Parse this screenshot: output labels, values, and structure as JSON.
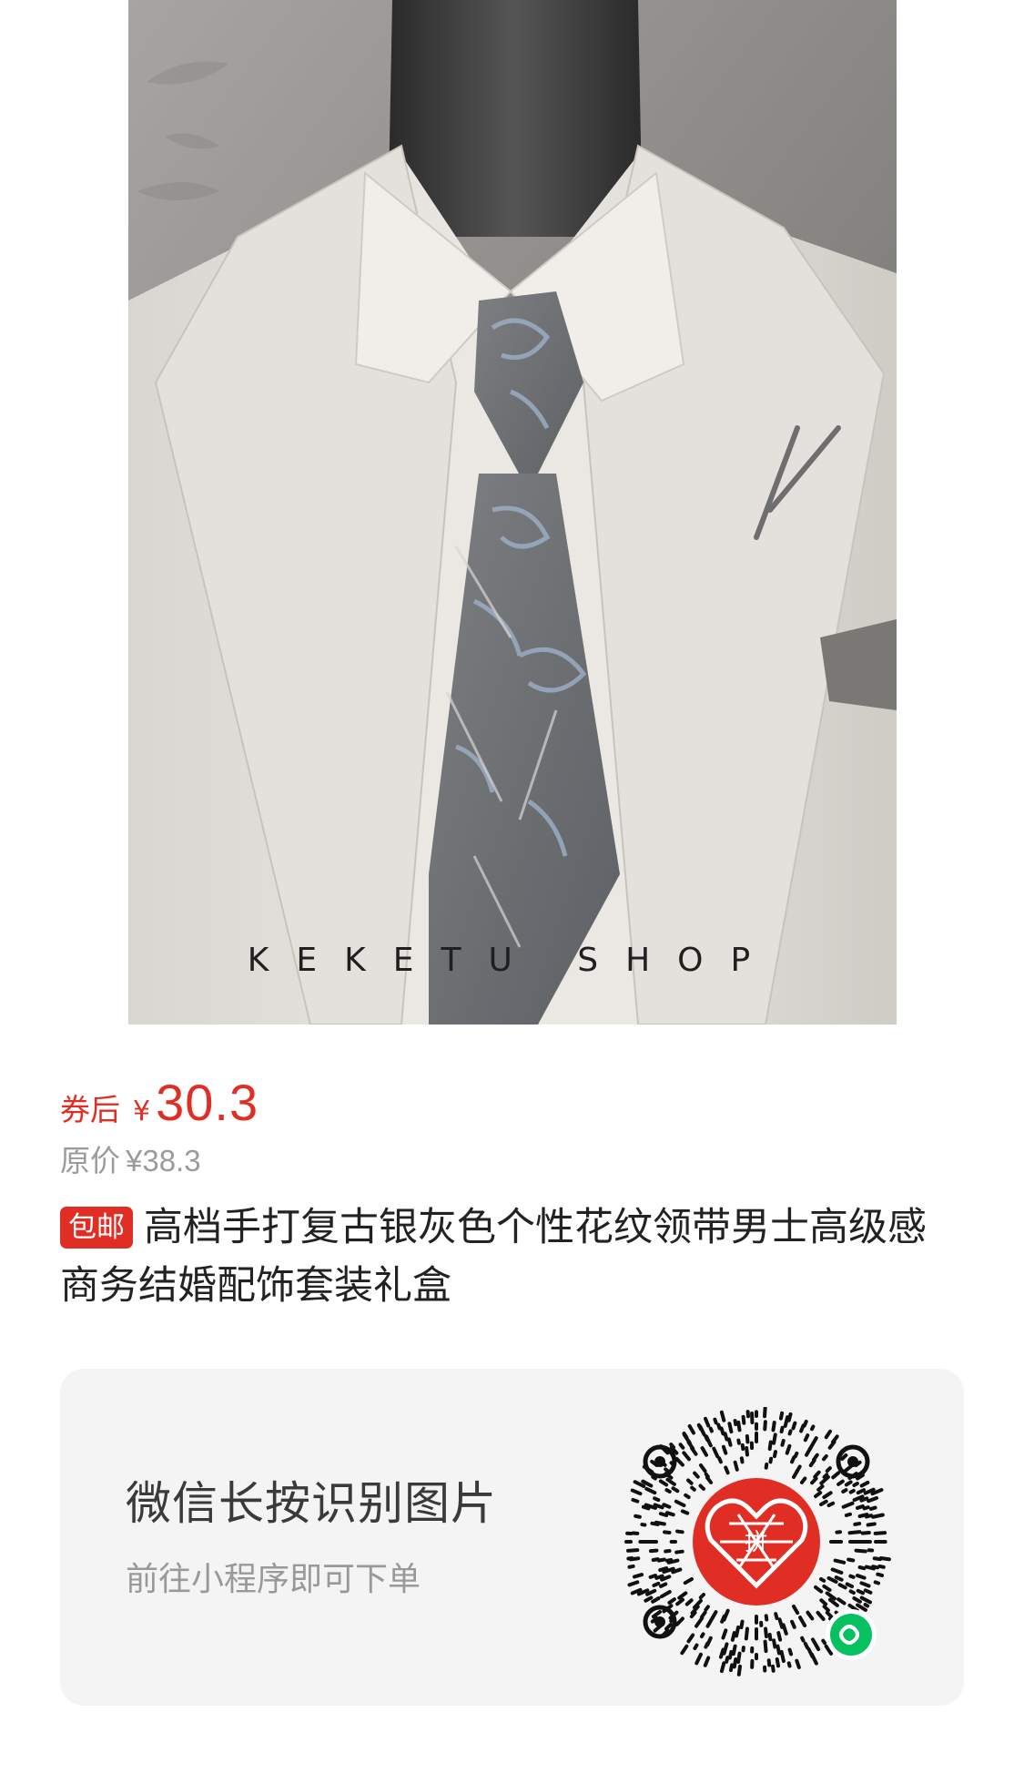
{
  "product_image": {
    "watermark": "KEKETU SHOP"
  },
  "price": {
    "label": "券后",
    "currency": "¥",
    "value": "30.3",
    "original_label": "原价",
    "original_value": "¥38.3"
  },
  "product": {
    "badge": "包邮",
    "title": "高档手打复古银灰色个性花纹领带男士高级感商务结婚配饰套装礼盒"
  },
  "mini_program_card": {
    "title": "微信长按识别图片",
    "subtitle": "前往小程序即可下单",
    "qr_center_icon": "pinduoduo-logo-icon",
    "qr_badge_icon": "wechat-miniprogram-icon"
  },
  "colors": {
    "accent": "#e02e24",
    "muted_text": "#9b9b9b",
    "card_bg": "#f4f4f4",
    "miniprogram_green": "#07c160"
  }
}
